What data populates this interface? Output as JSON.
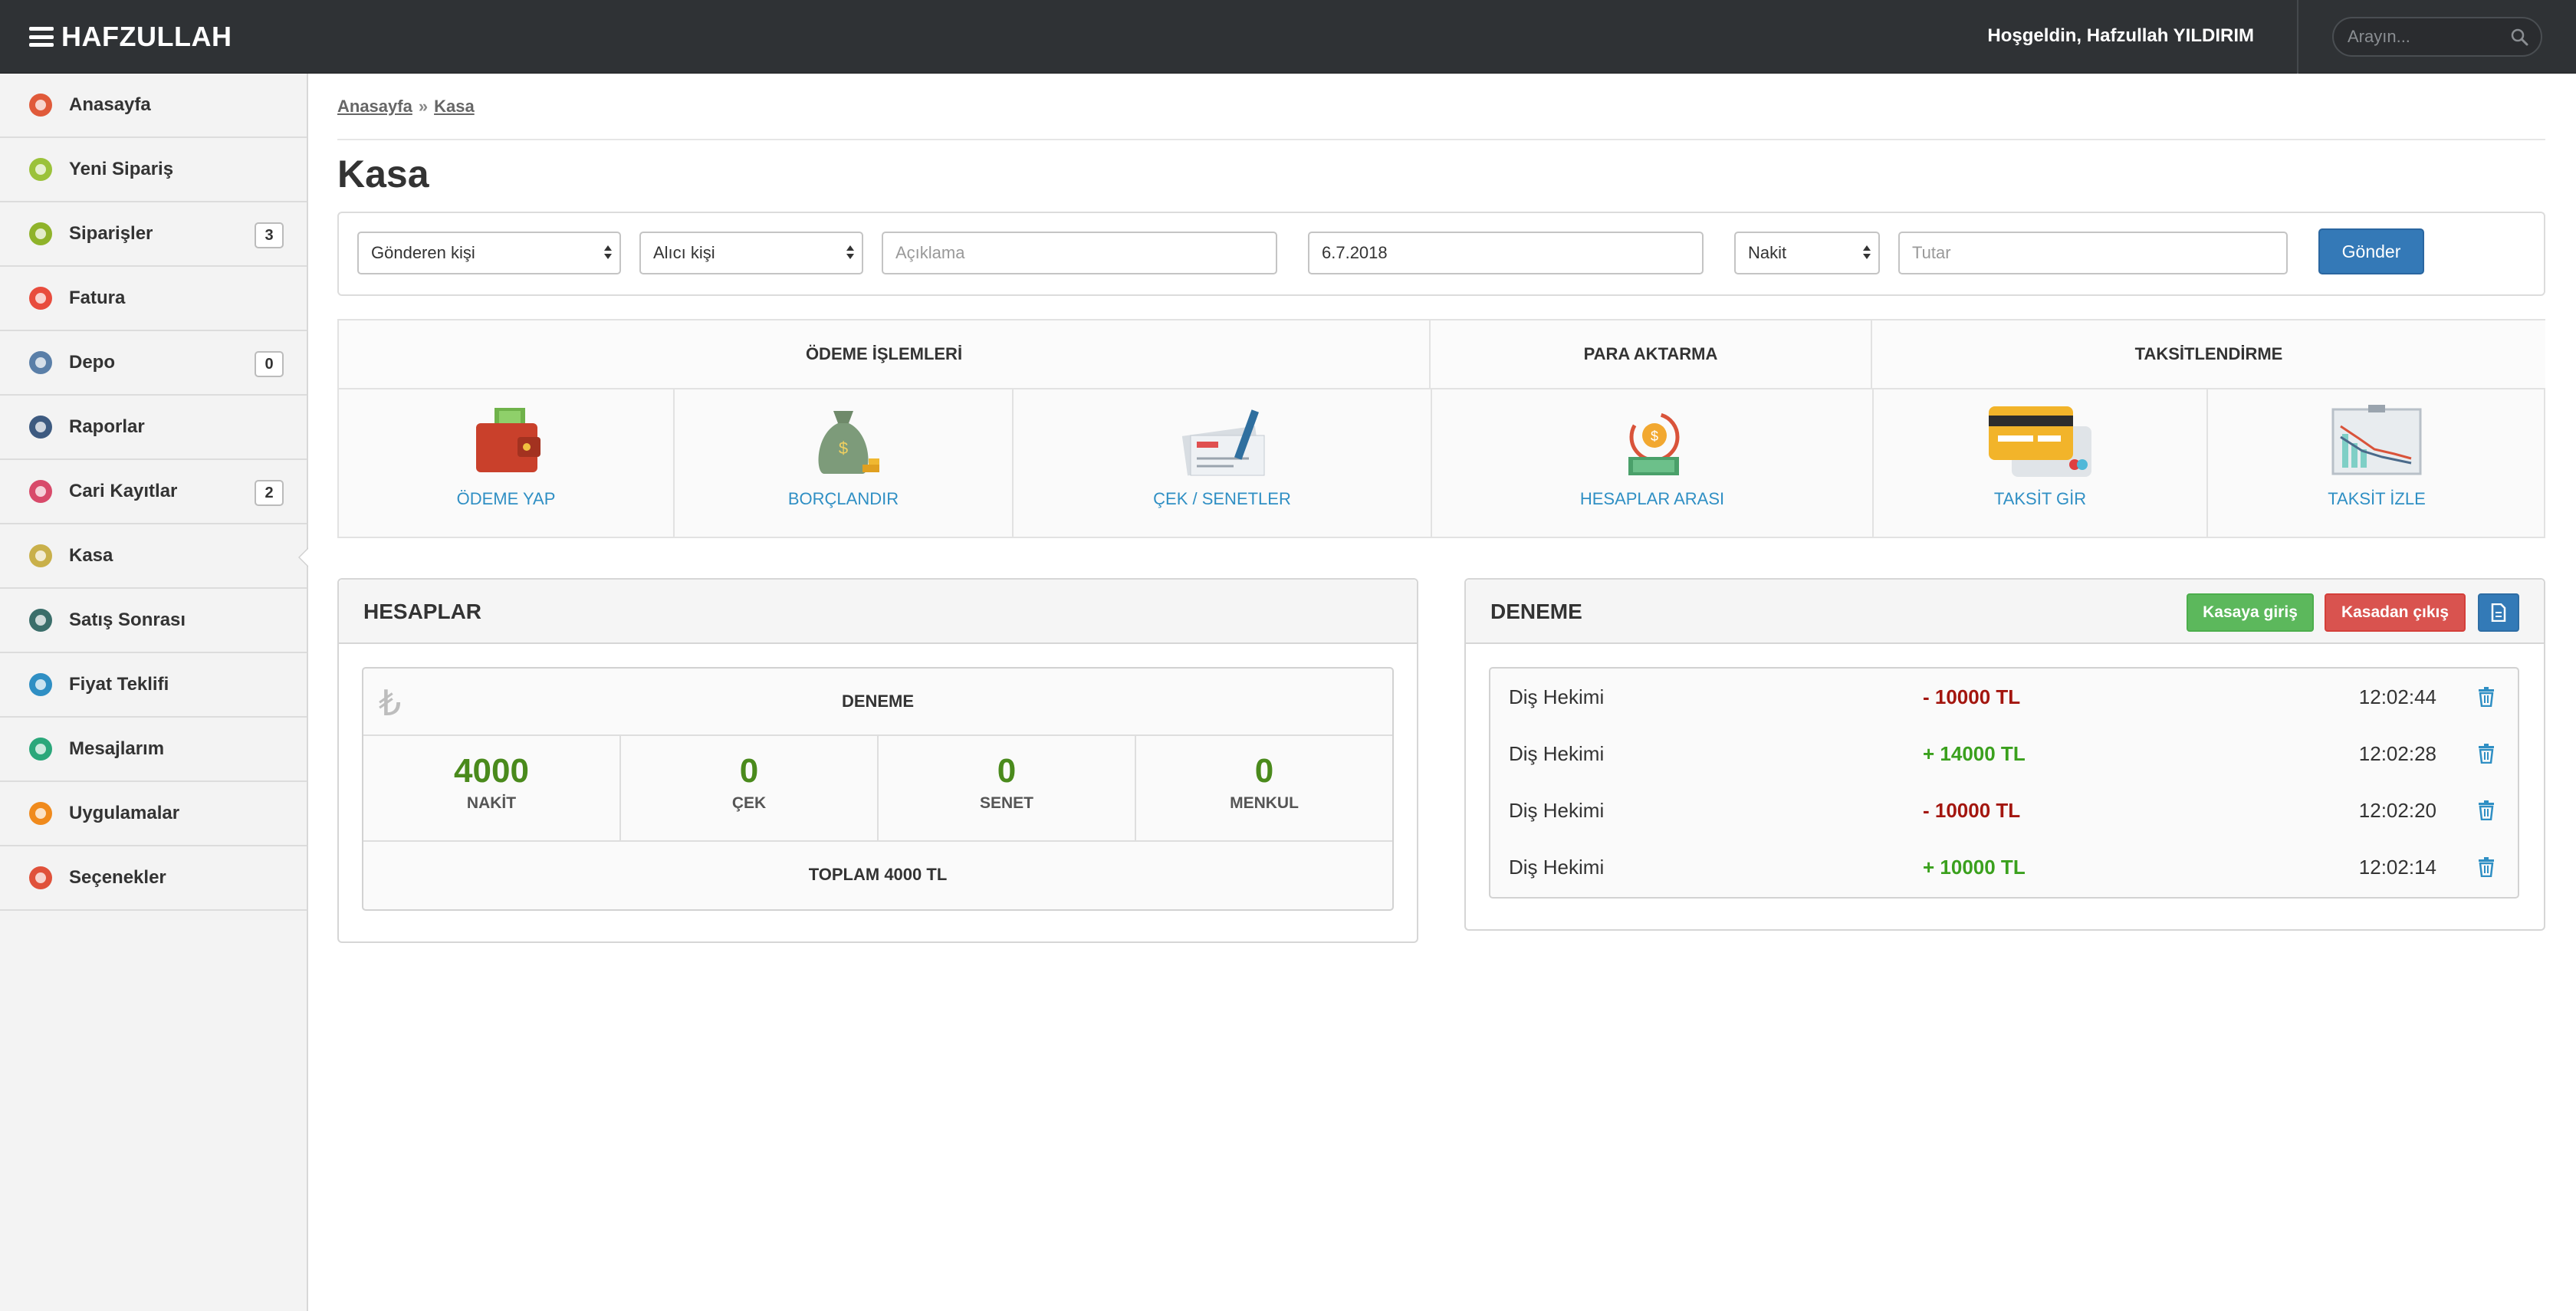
{
  "header": {
    "brand": "HAFZULLAH",
    "welcome": "Hoşgeldin, Hafzullah YILDIRIM",
    "search_placeholder": "Arayın..."
  },
  "sidebar": {
    "items": [
      {
        "label": "Anasayfa",
        "icon": "home-icon",
        "color": "#e05a3a"
      },
      {
        "label": "Yeni Sipariş",
        "icon": "new-order-icon",
        "color": "#9bc23a"
      },
      {
        "label": "Siparişler",
        "icon": "orders-icon",
        "color": "#8fb32a",
        "count": "3"
      },
      {
        "label": "Fatura",
        "icon": "invoice-icon",
        "color": "#e84c3d"
      },
      {
        "label": "Depo",
        "icon": "warehouse-icon",
        "color": "#5a7fa8",
        "count": "0"
      },
      {
        "label": "Raporlar",
        "icon": "reports-icon",
        "color": "#3d5a80"
      },
      {
        "label": "Cari Kayıtlar",
        "icon": "records-icon",
        "color": "#d84a6a",
        "count": "2"
      },
      {
        "label": "Kasa",
        "icon": "cash-register-icon",
        "color": "#c9b04a",
        "active": true
      },
      {
        "label": "Satış Sonrası",
        "icon": "after-sales-icon",
        "color": "#3a6e6a"
      },
      {
        "label": "Fiyat Teklifi",
        "icon": "price-offer-icon",
        "color": "#2f8fc4"
      },
      {
        "label": "Mesajlarım",
        "icon": "messages-icon",
        "color": "#2aa77a"
      },
      {
        "label": "Uygulamalar",
        "icon": "apps-icon",
        "color": "#f08a1c"
      },
      {
        "label": "Seçenekler",
        "icon": "settings-icon",
        "color": "#e0513a"
      }
    ]
  },
  "breadcrumb": {
    "home": "Anasayfa",
    "separator": "»",
    "current": "Kasa"
  },
  "page_title": "Kasa",
  "form": {
    "sender": "Gönderen kişi",
    "receiver": "Alıcı kişi",
    "description_placeholder": "Açıklama",
    "date": "6.7.2018",
    "payment_type": "Nakit",
    "amount_placeholder": "Tutar",
    "submit": "Gönder"
  },
  "operations": {
    "groups": [
      "ÖDEME İŞLEMLERİ",
      "PARA AKTARMA",
      "TAKSİTLENDİRME"
    ],
    "items": [
      {
        "label": "ÖDEME YAP",
        "icon": "wallet-icon"
      },
      {
        "label": "BORÇLANDIR",
        "icon": "money-bag-icon"
      },
      {
        "label": "ÇEK / SENETLER",
        "icon": "cheque-icon"
      },
      {
        "label": "HESAPLAR ARASI",
        "icon": "money-transfer-icon"
      },
      {
        "label": "TAKSİT GİR",
        "icon": "credit-card-icon"
      },
      {
        "label": "TAKSİT İZLE",
        "icon": "chart-board-icon"
      }
    ]
  },
  "accounts": {
    "title": "HESAPLAR",
    "account_name": "DENEME",
    "currency_icon": "₺",
    "stats": [
      {
        "value": "4000",
        "label": "NAKİT"
      },
      {
        "value": "0",
        "label": "ÇEK"
      },
      {
        "value": "0",
        "label": "SENET"
      },
      {
        "value": "0",
        "label": "MENKUL"
      }
    ],
    "total": "TOPLAM 4000 TL"
  },
  "transactions": {
    "title": "DENEME",
    "btn_in": "Kasaya giriş",
    "btn_out": "Kasadan çıkış",
    "rows": [
      {
        "desc": "Diş Hekimi",
        "amount": "- 10000 TL",
        "sign": "neg",
        "time": "12:02:44"
      },
      {
        "desc": "Diş Hekimi",
        "amount": "+ 14000 TL",
        "sign": "pos",
        "time": "12:02:28"
      },
      {
        "desc": "Diş Hekimi",
        "amount": "- 10000 TL",
        "sign": "neg",
        "time": "12:02:20"
      },
      {
        "desc": "Diş Hekimi",
        "amount": "+ 10000 TL",
        "sign": "pos",
        "time": "12:02:14"
      }
    ]
  }
}
